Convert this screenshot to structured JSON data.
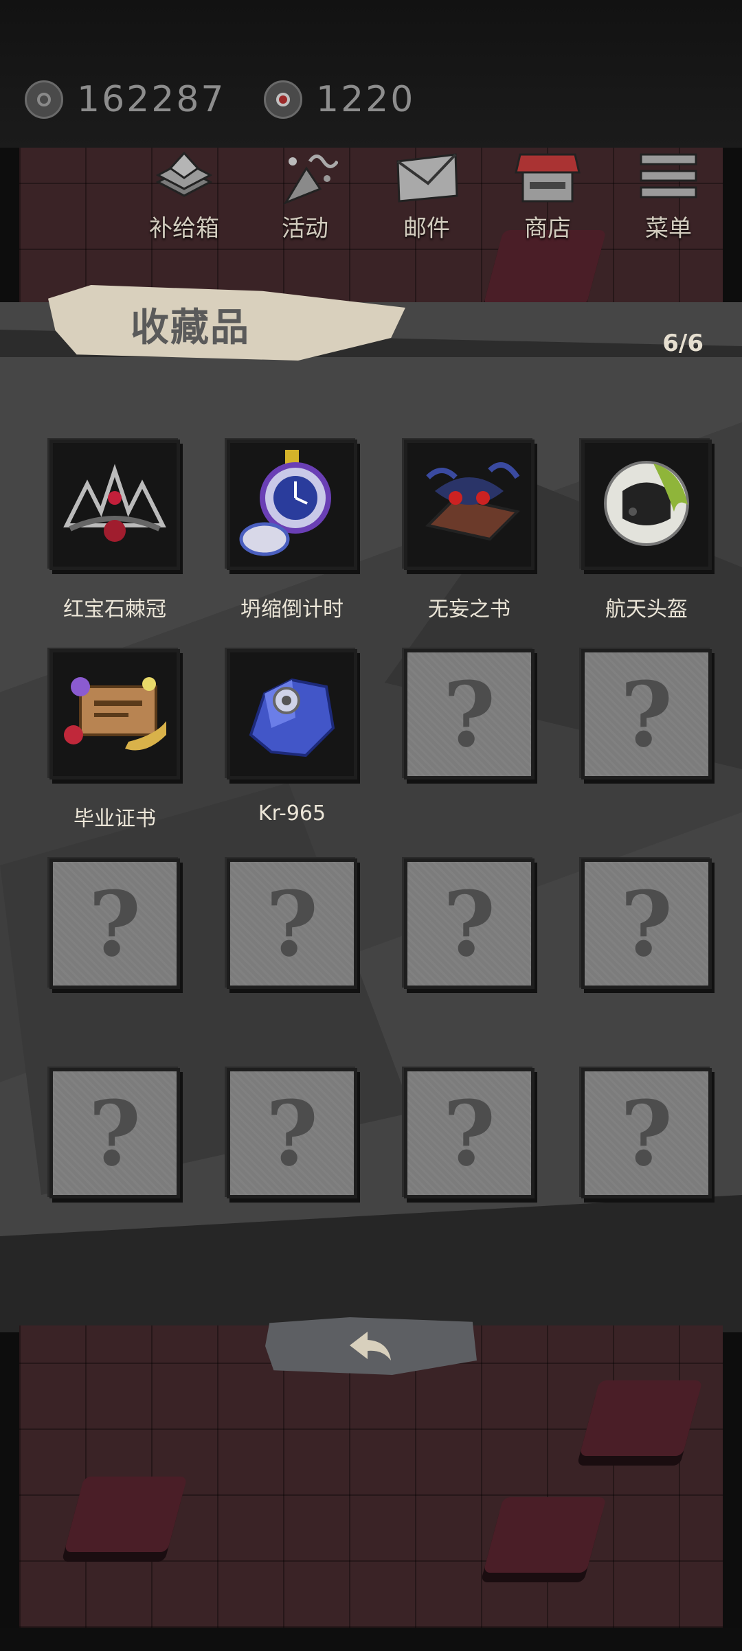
{
  "currencies": [
    {
      "icon": "coin-icon",
      "value": "162287"
    },
    {
      "icon": "red-gem-icon",
      "value": "1220"
    }
  ],
  "nav": [
    {
      "icon": "supply-box-icon",
      "label": "补给箱"
    },
    {
      "icon": "event-icon",
      "label": "活动"
    },
    {
      "icon": "mail-icon",
      "label": "邮件"
    },
    {
      "icon": "shop-icon",
      "label": "商店"
    },
    {
      "icon": "menu-icon",
      "label": "菜单"
    }
  ],
  "collection": {
    "title": "收藏品",
    "count": "6/6",
    "items": [
      {
        "name": "红宝石棘冠",
        "icon": "ruby-thorn-crown-icon",
        "unlocked": true,
        "color": "#b0243a"
      },
      {
        "name": "坍缩倒计时",
        "icon": "countdown-pocket-watch-icon",
        "unlocked": true,
        "color": "#3a4fd0"
      },
      {
        "name": "无妄之书",
        "icon": "cursed-book-icon",
        "unlocked": true,
        "color": "#2e3a78"
      },
      {
        "name": "航天头盔",
        "icon": "space-helmet-icon",
        "unlocked": true,
        "color": "#d6d6cf"
      },
      {
        "name": "毕业证书",
        "icon": "diploma-scroll-icon",
        "unlocked": true,
        "color": "#c69a5a"
      },
      {
        "name": "Kr-965",
        "icon": "crystal-shard-icon",
        "unlocked": true,
        "color": "#4d5ed6"
      },
      {
        "name": "",
        "icon": "locked-question-icon",
        "unlocked": false
      },
      {
        "name": "",
        "icon": "locked-question-icon",
        "unlocked": false
      },
      {
        "name": "",
        "icon": "locked-question-icon",
        "unlocked": false
      },
      {
        "name": "",
        "icon": "locked-question-icon",
        "unlocked": false
      },
      {
        "name": "",
        "icon": "locked-question-icon",
        "unlocked": false
      },
      {
        "name": "",
        "icon": "locked-question-icon",
        "unlocked": false
      },
      {
        "name": "",
        "icon": "locked-question-icon",
        "unlocked": false
      },
      {
        "name": "",
        "icon": "locked-question-icon",
        "unlocked": false
      },
      {
        "name": "",
        "icon": "locked-question-icon",
        "unlocked": false
      },
      {
        "name": "",
        "icon": "locked-question-icon",
        "unlocked": false
      }
    ]
  },
  "locked_symbol": "?",
  "back_button": {
    "icon": "back-arrow-icon"
  }
}
